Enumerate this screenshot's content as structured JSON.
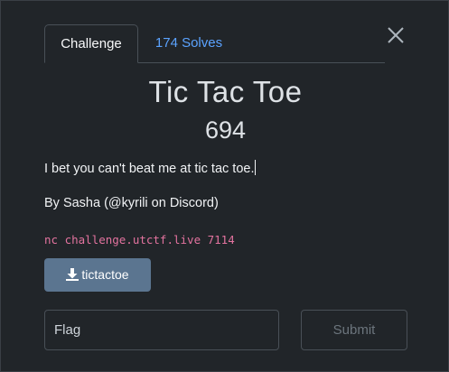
{
  "modal": {
    "tabs": [
      {
        "label": "Challenge",
        "active": true
      },
      {
        "label": "174 Solves",
        "active": false
      }
    ],
    "close_icon": "close-icon",
    "title": "Tic Tac Toe",
    "points": "694",
    "description": [
      "I bet you can't beat me at tic tac toe.",
      "By Sasha (@kyrili on Discord)"
    ],
    "connection": "nc challenge.utctf.live 7114",
    "download": {
      "label": "tictactoe",
      "icon": "download-icon"
    },
    "flag": {
      "placeholder": "Flag",
      "value": ""
    },
    "submit_label": "Submit"
  },
  "colors": {
    "background": "#212529",
    "link": "#5ba3ff",
    "code": "#e3739f",
    "download_button": "#5b7590"
  }
}
